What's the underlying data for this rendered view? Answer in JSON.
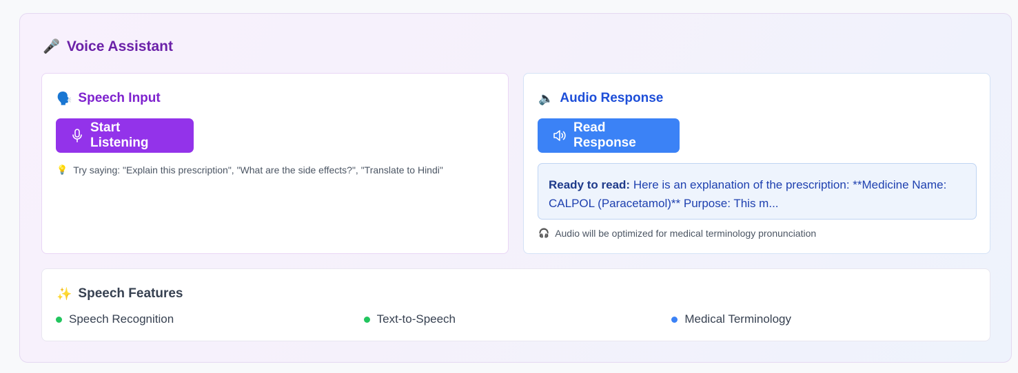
{
  "panel": {
    "title": "Voice Assistant",
    "icon": "microphone-icon"
  },
  "speech_input": {
    "title": "Speech Input",
    "icon": "speaking-head-icon",
    "button_label": "Start Listening",
    "button_icon": "mic-icon",
    "hint_icon": "lightbulb-icon",
    "hint": "Try saying: \"Explain this prescription\", \"What are the side effects?\", \"Translate to Hindi\""
  },
  "audio_response": {
    "title": "Audio Response",
    "icon": "speaker-icon",
    "button_label": "Read Response",
    "button_icon": "volume-icon",
    "ready_label": "Ready to read:",
    "ready_text": "Here is an explanation of the prescription: **Medicine Name: CALPOL (Paracetamol)** Purpose: This m...",
    "note_icon": "headphones-icon",
    "note": "Audio will be optimized for medical terminology pronunciation"
  },
  "features": {
    "title": "Speech Features",
    "icon": "sparkles-icon",
    "items": [
      {
        "label": "Speech Recognition",
        "color": "#22c55e"
      },
      {
        "label": "Text-to-Speech",
        "color": "#22c55e"
      },
      {
        "label": "Medical Terminology",
        "color": "#3b82f6"
      }
    ]
  },
  "colors": {
    "purple_accent": "#9333ea",
    "blue_accent": "#3b82f6",
    "title_purple": "#6b21a8"
  }
}
